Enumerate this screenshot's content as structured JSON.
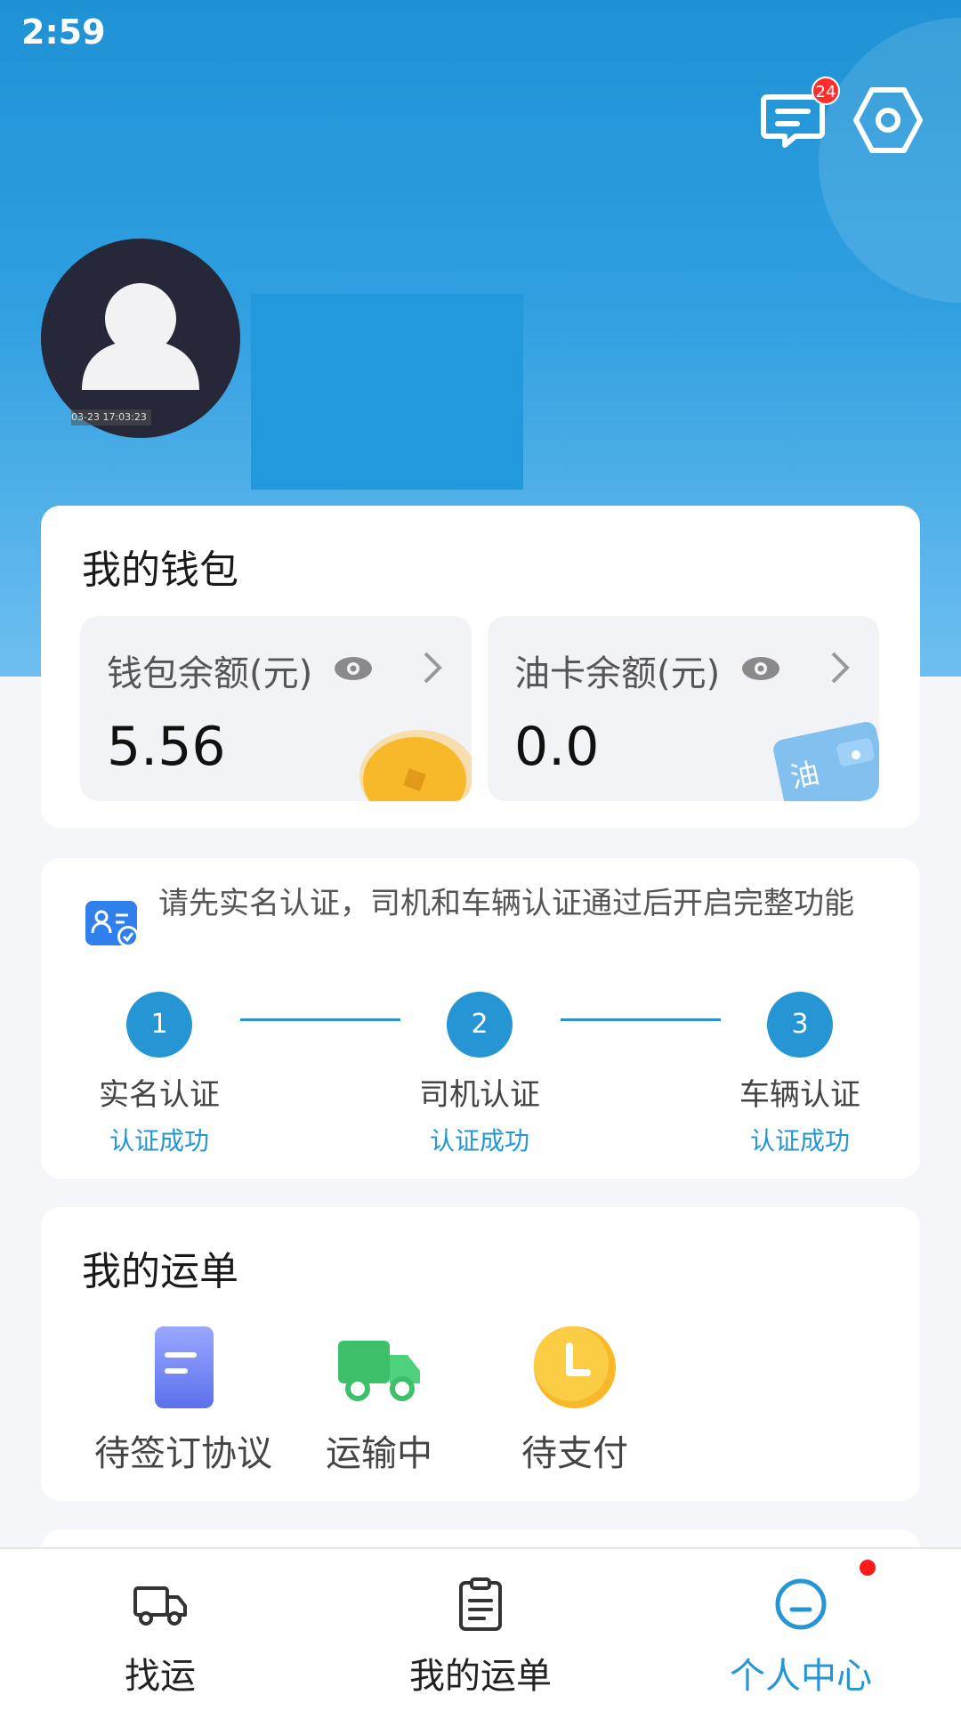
{
  "status_bar": {
    "time": "2:59"
  },
  "header": {
    "message_badge": "24",
    "avatar_stamp": "03-23 17:03:23",
    "accent_color": "#1e92d5"
  },
  "wallet": {
    "title": "我的钱包",
    "balance": {
      "label": "钱包余额(元)",
      "value": "5.56"
    },
    "fuel_card": {
      "label": "油卡余额(元)",
      "value": "0.0",
      "deco_text": "油"
    }
  },
  "verification": {
    "notice": "请先实名认证，司机和车辆认证通过后开启完整功能",
    "steps": [
      {
        "num": "1",
        "label": "实名认证",
        "status": "认证成功"
      },
      {
        "num": "2",
        "label": "司机认证",
        "status": "认证成功"
      },
      {
        "num": "3",
        "label": "车辆认证",
        "status": "认证成功"
      }
    ]
  },
  "orders": {
    "title": "我的运单",
    "items": [
      {
        "label": "待签订协议",
        "icon": "document-icon"
      },
      {
        "label": "运输中",
        "icon": "truck-icon"
      },
      {
        "label": "待支付",
        "icon": "clock-icon"
      }
    ]
  },
  "tabbar": {
    "tabs": [
      {
        "label": "找运",
        "icon": "truck-outline-icon",
        "active": false
      },
      {
        "label": "我的运单",
        "icon": "clipboard-icon",
        "active": false
      },
      {
        "label": "个人中心",
        "icon": "profile-icon",
        "active": true
      }
    ],
    "active_color": "#2596d3"
  }
}
